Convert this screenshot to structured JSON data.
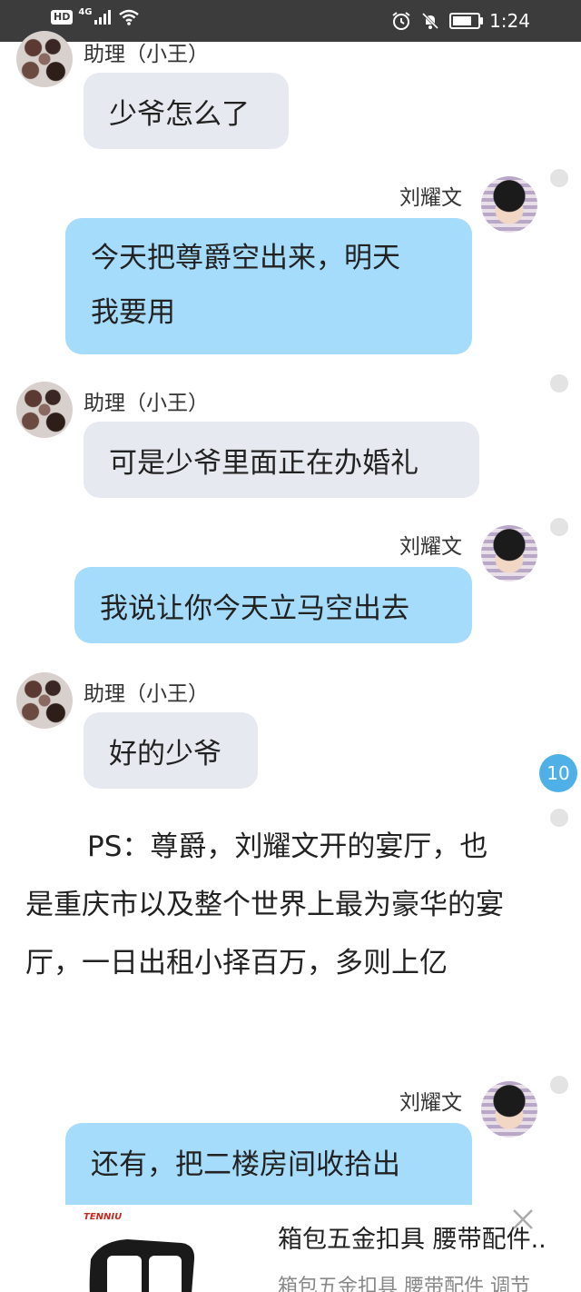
{
  "status_bar": {
    "hd": "HD",
    "network": "4G",
    "time": "1:24",
    "battery_level": 0.85
  },
  "messages": [
    {
      "side": "left",
      "name": "助理（小王）",
      "text": "少爷怎么了"
    },
    {
      "side": "right",
      "name": "刘耀文",
      "text_lines": [
        "今天把尊爵空出来，明天",
        "我要用"
      ]
    },
    {
      "side": "left",
      "name": "助理（小王）",
      "text": "可是少爷里面正在办婚礼"
    },
    {
      "side": "right",
      "name": "刘耀文",
      "text": "我说让你今天立马空出去"
    },
    {
      "side": "left",
      "name": "助理（小王）",
      "text": "好的少爷"
    },
    {
      "side": "right",
      "name": "刘耀文",
      "text": "还有，把二楼房间收拾出"
    }
  ],
  "unread_badge": "10",
  "narration": "PS：尊爵，刘耀文开的宴厅，也是重庆市以及整个世界上最为豪华的宴厅，一日出租小择百万，多则上亿",
  "ad": {
    "brand": "TENNIU",
    "title": "箱包五金扣具 腰带配件..",
    "subtitle": "箱包五金扣具 腰带配件 调节"
  },
  "colors": {
    "left_bubble": "#e6e9ef",
    "right_bubble": "#a6dcfb",
    "badge": "#4fb0e8",
    "status_bar": "#3c3c3c"
  }
}
